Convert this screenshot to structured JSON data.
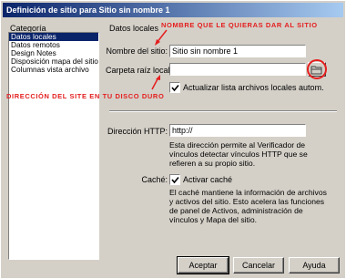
{
  "window": {
    "title": "Definición de sitio para Sitio sin nombre 1"
  },
  "sidebar": {
    "label": "Categoría",
    "items": [
      {
        "label": "Datos locales",
        "selected": true
      },
      {
        "label": "Datos remotos",
        "selected": false
      },
      {
        "label": "Design Notes",
        "selected": false
      },
      {
        "label": "Disposición mapa del sitio",
        "selected": false
      },
      {
        "label": "Columnas vista archivo",
        "selected": false
      }
    ]
  },
  "main": {
    "section_title": "Datos locales",
    "site_name": {
      "label": "Nombre del sitio:",
      "value": "Sitio sin nombre 1"
    },
    "root_folder": {
      "label": "Carpeta raíz local:",
      "value": ""
    },
    "refresh_checkbox": {
      "label": "Actualizar lista archivos locales autom.",
      "checked": true
    },
    "http": {
      "label": "Dirección HTTP:",
      "value": "http://",
      "desc": "Esta dirección permite al Verificador de vínculos detectar vínculos HTTP que se refieren a su propio sitio."
    },
    "cache": {
      "label": "Caché:",
      "checkbox_label": "Activar caché",
      "checked": true,
      "desc": "El caché mantiene la información de archivos y activos del sitio. Esto acelera las funciones de panel de Activos, administración de vínculos y Mapa del sitio."
    }
  },
  "annotations": {
    "site_name_note": "NOMBRE QUE LE QUIERAS DAR AL SITIO",
    "root_folder_note": "DIRECCIÓN DEL SITE EN TU DISCO DURO",
    "color": "#e41e1e"
  },
  "buttons": {
    "ok": "Aceptar",
    "cancel": "Cancelar",
    "help": "Ayuda"
  },
  "colors": {
    "titlebar_start": "#0a246a",
    "titlebar_end": "#a6caf0",
    "face": "#d4d0c8"
  }
}
